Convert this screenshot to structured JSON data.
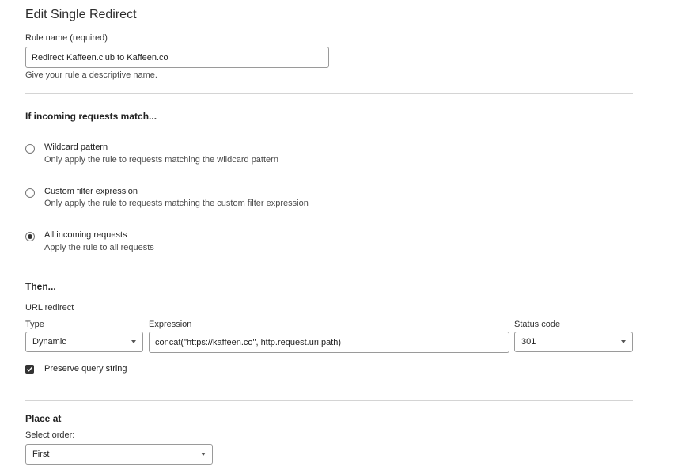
{
  "page": {
    "title": "Edit Single Redirect"
  },
  "rule_name": {
    "label": "Rule name (required)",
    "value": "Redirect Kaffeen.club to Kaffeen.co",
    "help": "Give your rule a descriptive name."
  },
  "match": {
    "heading": "If incoming requests match...",
    "options": [
      {
        "title": "Wildcard pattern",
        "description": "Only apply the rule to requests matching the wildcard pattern",
        "selected": false
      },
      {
        "title": "Custom filter expression",
        "description": "Only apply the rule to requests matching the custom filter expression",
        "selected": false
      },
      {
        "title": "All incoming requests",
        "description": "Apply the rule to all requests",
        "selected": true
      }
    ]
  },
  "then": {
    "heading": "Then...",
    "action_label": "URL redirect",
    "type": {
      "label": "Type",
      "value": "Dynamic"
    },
    "expression": {
      "label": "Expression",
      "value": "concat(\"https://kaffeen.co\", http.request.uri.path)"
    },
    "status_code": {
      "label": "Status code",
      "value": "301"
    },
    "preserve_query": {
      "label": "Preserve query string",
      "checked": true
    }
  },
  "place_at": {
    "heading": "Place at",
    "order_label": "Select order:",
    "order_value": "First"
  }
}
